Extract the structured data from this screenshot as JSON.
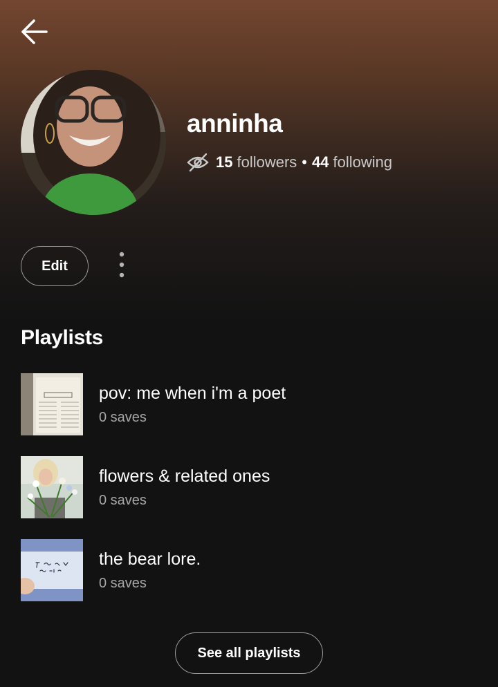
{
  "header": {
    "back_icon": "arrow-left-icon"
  },
  "profile": {
    "username": "anninha",
    "visibility_icon": "eye-off-icon",
    "followers_count": "15",
    "followers_label": "followers",
    "separator": "•",
    "following_count": "44",
    "following_label": "following"
  },
  "actions": {
    "edit_label": "Edit",
    "more_icon": "more-vertical-icon"
  },
  "playlists": {
    "title": "Playlists",
    "items": [
      {
        "name": "pov: me when i'm a poet",
        "saves": "0 saves"
      },
      {
        "name": "flowers & related ones",
        "saves": "0 saves"
      },
      {
        "name": "the bear lore.",
        "saves": "0 saves"
      }
    ],
    "see_all_label": "See all playlists"
  },
  "colors": {
    "background": "#121212",
    "header_gradient_top": "#734630",
    "text_primary": "#ffffff",
    "text_secondary": "#a7a7a7",
    "button_border": "#9a9a9a"
  }
}
